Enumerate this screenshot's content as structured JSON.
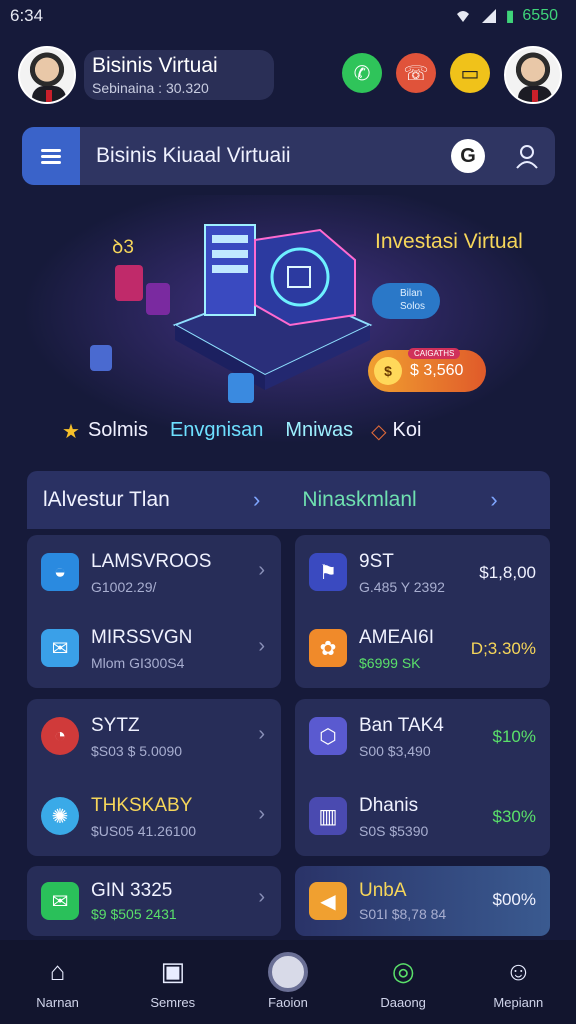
{
  "status_bar": {
    "time": "6:34",
    "battery": "6550"
  },
  "profile": {
    "name": "Bisinis Virtuai",
    "subtitle": "Sebinaina : 30.320"
  },
  "actions": {
    "phone_icon": "phone-icon",
    "chat_icon": "chat-icon",
    "message_icon": "message-icon"
  },
  "search": {
    "title": "Bisinis Kiuaal Virtuaii",
    "g_label": "G"
  },
  "hero": {
    "title": "Investasi Virtual",
    "left_tag": "ꝺ3",
    "pill_1": "Bilan\nSolos",
    "pill_2": "",
    "price_mini": "CAIGATHS",
    "price": "$ 3,560",
    "tags": [
      "Solmis",
      "Envgnisan",
      "Mniwas",
      "Koi"
    ]
  },
  "panel": {
    "left_label": "lAlvestur Tlan",
    "right_label": "Ninaskmlanl"
  },
  "cards": {
    "left_top": [
      {
        "title": "LAMSVROOS",
        "sub": "G1002.29/"
      },
      {
        "title": "MIRSSVGN",
        "sub": "Mlom   GI300S4"
      }
    ],
    "right_top": [
      {
        "title": "9ST",
        "sub": "G.485 Y 2392",
        "value": "$1,8,00"
      },
      {
        "title": "AMEAI6I",
        "sub": "$6999 SK",
        "value": "D;3.30%"
      }
    ],
    "left_mid": [
      {
        "title": "SYTZ",
        "sub": "$S03  $ 5.0090"
      },
      {
        "title": "THKSKABY",
        "sub": "$US05   41.26100"
      }
    ],
    "right_mid": [
      {
        "title": "Ban TAK4",
        "sub": "S00  $3,490",
        "value": "$10%"
      },
      {
        "title": "Dhanis",
        "sub": "S0S  $5390",
        "value": "$30%"
      }
    ],
    "left_bottom": {
      "title": "GIN 3325",
      "sub": "$9 $505 2431"
    },
    "right_bottom": {
      "title": "UnbA",
      "sub": "S01I   $8,78 84",
      "value": "$00%"
    }
  },
  "nav": [
    {
      "label": "Narnan",
      "icon": "home-icon"
    },
    {
      "label": "Semres",
      "icon": "services-icon"
    },
    {
      "label": "Faoion",
      "icon": "center-icon"
    },
    {
      "label": "Daaong",
      "icon": "target-icon"
    },
    {
      "label": "Mepiann",
      "icon": "profile-icon"
    }
  ],
  "colors": {
    "background": "#161a3a",
    "card": "#272d58",
    "accent_blue": "#3a63c9",
    "accent_green": "#5ae06a",
    "accent_gold": "#f6d65a"
  }
}
